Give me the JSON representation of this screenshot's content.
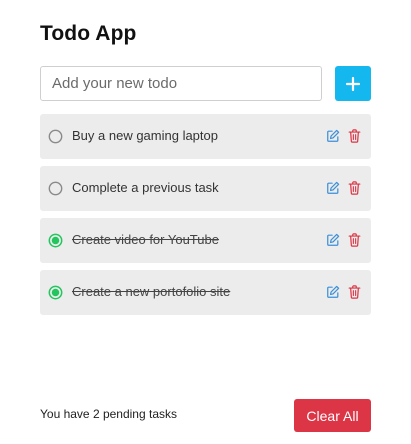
{
  "app": {
    "title": "Todo App"
  },
  "input": {
    "placeholder": "Add your new todo",
    "value": ""
  },
  "add_button": {
    "icon": "plus-icon",
    "color": "#14b8ef"
  },
  "todos": [
    {
      "text": "Buy a new gaming laptop",
      "completed": false
    },
    {
      "text": "Complete a previous task",
      "completed": false
    },
    {
      "text": "Create video for YouTube",
      "completed": true
    },
    {
      "text": "Create a new portofolio site",
      "completed": true
    }
  ],
  "item_icons": {
    "edit": "edit-icon",
    "delete": "trash-icon",
    "edit_color": "#3b8fd9",
    "delete_color": "#dc3545",
    "check_done_color": "#22c55e"
  },
  "footer": {
    "pending_text": "You have 2 pending tasks",
    "clear_label": "Clear All",
    "clear_color": "#dc3545"
  }
}
